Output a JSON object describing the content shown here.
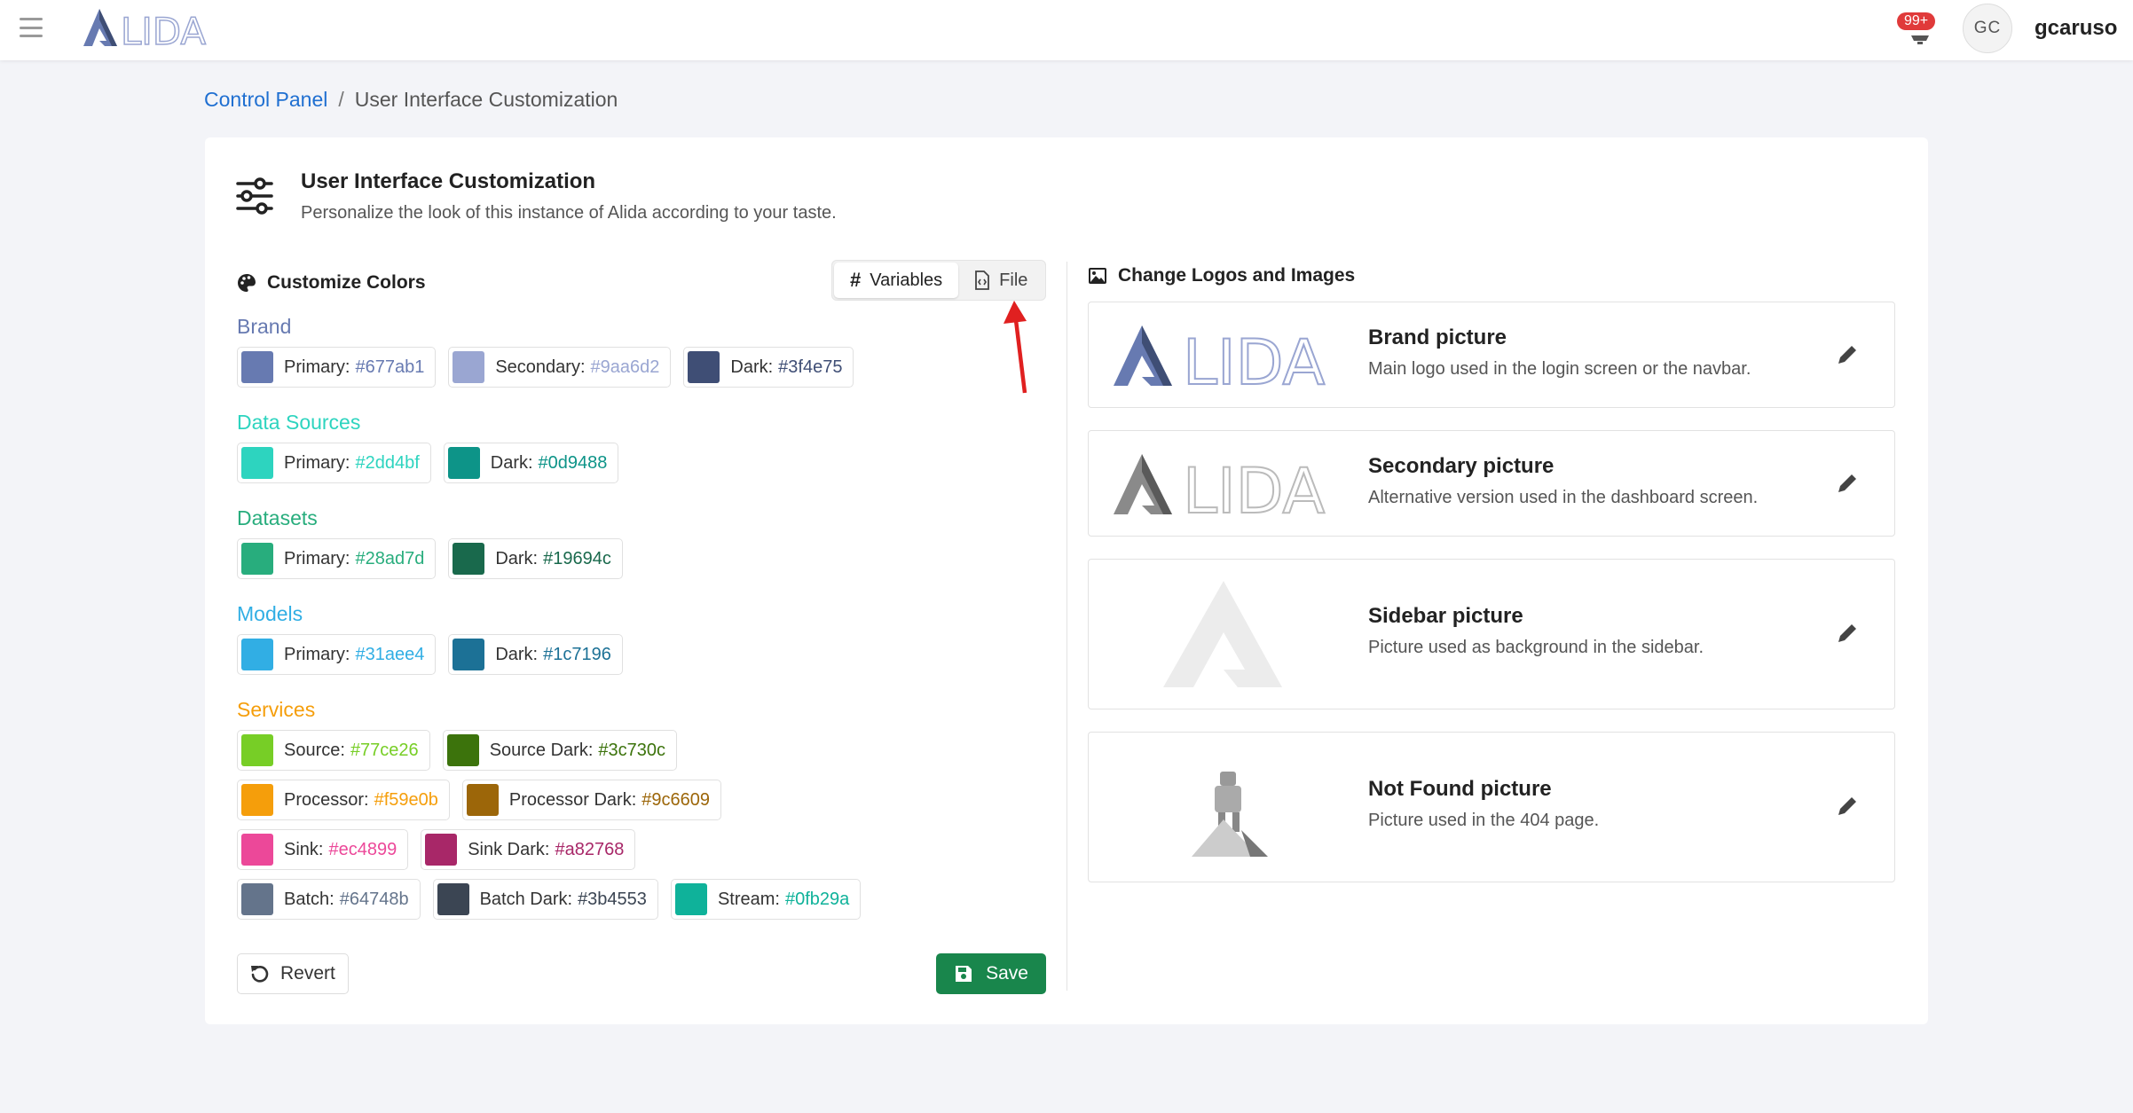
{
  "navbar": {
    "notification_count": "99+",
    "avatar_initials": "GC",
    "username": "gcaruso",
    "logo_text": "LIDA"
  },
  "breadcrumb": {
    "parent": "Control Panel",
    "separator": "/",
    "current": "User Interface Customization"
  },
  "header": {
    "title": "User Interface Customization",
    "subtitle": "Personalize the look of this instance of Alida according to your taste."
  },
  "colors_panel": {
    "title": "Customize Colors",
    "tabs": [
      {
        "label": "Variables",
        "active": true
      },
      {
        "label": "File",
        "active": false
      }
    ],
    "groups": [
      {
        "label": "Brand",
        "color": "#677ab1",
        "chips": [
          {
            "label": "Primary:",
            "value": "#677ab1",
            "swatch": "#677ab1"
          },
          {
            "label": "Secondary:",
            "value": "#9aa6d2",
            "swatch": "#9aa6d2"
          },
          {
            "label": "Dark:",
            "value": "#3f4e75",
            "swatch": "#3f4e75"
          }
        ]
      },
      {
        "label": "Data Sources",
        "color": "#2dd4bf",
        "chips": [
          {
            "label": "Primary:",
            "value": "#2dd4bf",
            "swatch": "#2dd4bf"
          },
          {
            "label": "Dark:",
            "value": "#0d9488",
            "swatch": "#0d9488"
          }
        ]
      },
      {
        "label": "Datasets",
        "color": "#28ad7d",
        "chips": [
          {
            "label": "Primary:",
            "value": "#28ad7d",
            "swatch": "#28ad7d"
          },
          {
            "label": "Dark:",
            "value": "#19694c",
            "swatch": "#19694c"
          }
        ]
      },
      {
        "label": "Models",
        "color": "#31aee4",
        "chips": [
          {
            "label": "Primary:",
            "value": "#31aee4",
            "swatch": "#31aee4"
          },
          {
            "label": "Dark:",
            "value": "#1c7196",
            "swatch": "#1c7196"
          }
        ]
      },
      {
        "label": "Services",
        "color": "#f59e0b",
        "chips": [
          {
            "label": "Source:",
            "value": "#77ce26",
            "swatch": "#77ce26"
          },
          {
            "label": "Source Dark:",
            "value": "#3c730c",
            "swatch": "#3c730c"
          },
          {
            "label": "Processor:",
            "value": "#f59e0b",
            "swatch": "#f59e0b"
          },
          {
            "label": "Processor Dark:",
            "value": "#9c6609",
            "swatch": "#9c6609"
          },
          {
            "label": "Sink:",
            "value": "#ec4899",
            "swatch": "#ec4899"
          },
          {
            "label": "Sink Dark:",
            "value": "#a82768",
            "swatch": "#a82768"
          },
          {
            "label": "Batch:",
            "value": "#64748b",
            "swatch": "#64748b"
          },
          {
            "label": "Batch Dark:",
            "value": "#3b4553",
            "swatch": "#3b4553"
          },
          {
            "label": "Stream:",
            "value": "#0fb29a",
            "swatch": "#0fb29a"
          }
        ]
      }
    ],
    "revert_label": "Revert",
    "save_label": "Save"
  },
  "images_panel": {
    "title": "Change Logos and Images",
    "items": [
      {
        "name": "Brand picture",
        "description": "Main logo used in the login screen or the navbar."
      },
      {
        "name": "Secondary picture",
        "description": "Alternative version used in the dashboard screen."
      },
      {
        "name": "Sidebar picture",
        "description": "Picture used as background in the sidebar."
      },
      {
        "name": "Not Found picture",
        "description": "Picture used in the 404 page."
      }
    ]
  }
}
